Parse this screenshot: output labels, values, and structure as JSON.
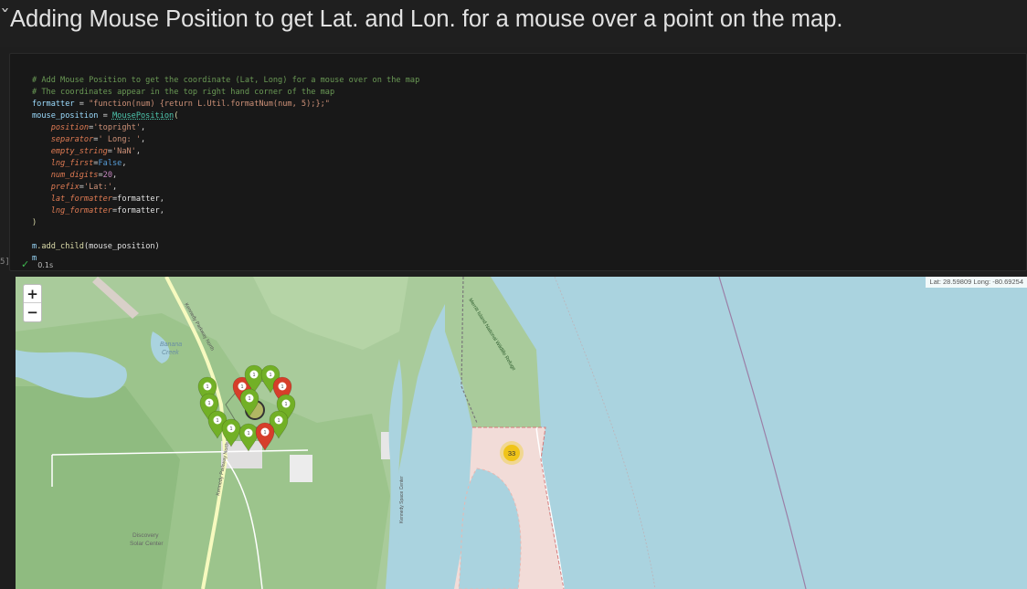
{
  "heading": {
    "chevron": "ˇ",
    "title": "Adding Mouse Position to get Lat. and Lon. for a mouse over a point on the map."
  },
  "cell": {
    "execution_count": "5]",
    "status_time": "0.1s",
    "code": {
      "l1": "# Add Mouse Position to get the coordinate (Lat, Long) for a mouse over on the map",
      "l2": "# The coordinates appear in the top right hand corner of the map",
      "l3_var": "formatter",
      "l3_op": " = ",
      "l3_str": "\"function(num) {return L.Util.formatNum(num, 5);};\"",
      "l4_var": "mouse_position",
      "l4_op": " = ",
      "l4_cls": "MousePosition",
      "l4_paren": "(",
      "p1_name": "position",
      "p1_val": "'topright'",
      "p2_name": "separator",
      "p2_val": "' Long: '",
      "p3_name": "empty_string",
      "p3_val": "'NaN'",
      "p4_name": "lng_first",
      "p4_val": "False",
      "p5_name": "num_digits",
      "p5_val": "20",
      "p6_name": "prefix",
      "p6_val": "'Lat:'",
      "p7_name": "lat_formatter",
      "p7_val": "formatter",
      "p8_name": "lng_formatter",
      "p8_val": "formatter",
      "close": ")",
      "l_call_obj": "m",
      "l_call_fn": ".add_child",
      "l_call_arg": "(mouse_position)",
      "l_last": "m"
    }
  },
  "map": {
    "zoom_in": "+",
    "zoom_out": "−",
    "mouse_position_text": "Lat: 28.59809 Long: -80.69254",
    "cluster_count": "33",
    "marker_label": "1",
    "place_labels": {
      "banana_creek_1": "Banana",
      "banana_creek_2": "Creek",
      "road_north": "Kennedy Parkway North",
      "road_west": "Kennedy Parkway North",
      "road_coastal": "Merritt Island National Wildlife Refuge",
      "discovery_1": "Discovery",
      "discovery_2": "Solar Center",
      "road_east": "Kennedy Space Center"
    },
    "colors": {
      "water": "#aad3df",
      "land": "#a8c99a",
      "forest": "#8fbd7f",
      "restricted": "#f2d9d6",
      "marker_green": "#72b026",
      "marker_red": "#d63e2a",
      "cluster": "#f1d357"
    }
  }
}
